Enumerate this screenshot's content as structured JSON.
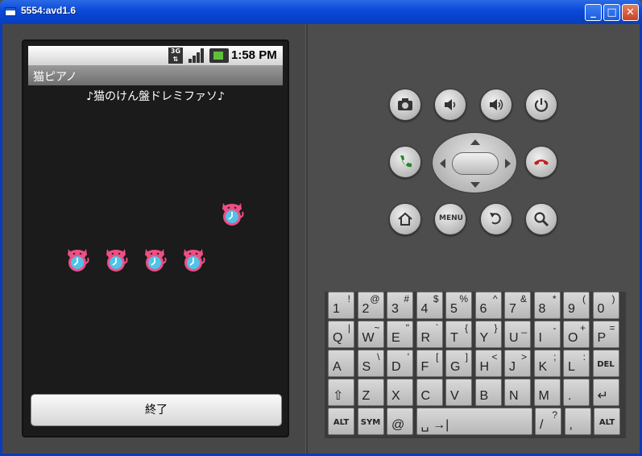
{
  "window": {
    "title": "5554:avd1.6",
    "minimize": "_",
    "maximize": "□",
    "close": "✕"
  },
  "status_bar": {
    "network": "3G",
    "time": "1:58 PM"
  },
  "app": {
    "title": "猫ピアノ",
    "subtitle": "♪猫のけん盤ドレミファソ♪",
    "exit_button": "終了"
  },
  "cats": [
    {
      "name": "cat-key-do"
    },
    {
      "name": "cat-key-re"
    },
    {
      "name": "cat-key-mi"
    },
    {
      "name": "cat-key-fa"
    },
    {
      "name": "cat-key-so"
    }
  ],
  "emulator_buttons": {
    "menu_label": "MENU"
  },
  "keyboard": {
    "rows": [
      [
        [
          "1",
          "!"
        ],
        [
          "2",
          "@"
        ],
        [
          "3",
          "#"
        ],
        [
          "4",
          "$"
        ],
        [
          "5",
          "%"
        ],
        [
          "6",
          "^"
        ],
        [
          "7",
          "&"
        ],
        [
          "8",
          "*"
        ],
        [
          "9",
          "("
        ],
        [
          "0",
          ")"
        ]
      ],
      [
        [
          "Q",
          "|"
        ],
        [
          "W",
          "~"
        ],
        [
          "E",
          "\""
        ],
        [
          "R",
          "`"
        ],
        [
          "T",
          "{"
        ],
        [
          "Y",
          "}"
        ],
        [
          "U",
          "_"
        ],
        [
          "I",
          "-"
        ],
        [
          "O",
          "+"
        ],
        [
          "P",
          "="
        ]
      ],
      [
        [
          "A",
          ""
        ],
        [
          "S",
          "\\"
        ],
        [
          "D",
          "'"
        ],
        [
          "F",
          "["
        ],
        [
          "G",
          "]"
        ],
        [
          "H",
          "<"
        ],
        [
          "J",
          ">"
        ],
        [
          "K",
          ";"
        ],
        [
          "L",
          ":"
        ],
        [
          "DEL",
          ""
        ]
      ],
      [
        [
          "⇧",
          ""
        ],
        [
          "Z",
          ""
        ],
        [
          "X",
          ""
        ],
        [
          "C",
          ""
        ],
        [
          "V",
          ""
        ],
        [
          "B",
          ""
        ],
        [
          "N",
          ""
        ],
        [
          "M",
          ""
        ],
        [
          ".",
          ""
        ],
        [
          "↵",
          ""
        ]
      ]
    ],
    "bottom": {
      "alt_left": "ALT",
      "sym": "SYM",
      "at": "@",
      "space": "␣",
      "tab": "→|",
      "slash": "/",
      "question": "?",
      "comma": ",",
      "alt_right": "ALT"
    }
  },
  "colors": {
    "cat_pink": "#ee4f86",
    "cat_blue": "#4fc3e8"
  }
}
